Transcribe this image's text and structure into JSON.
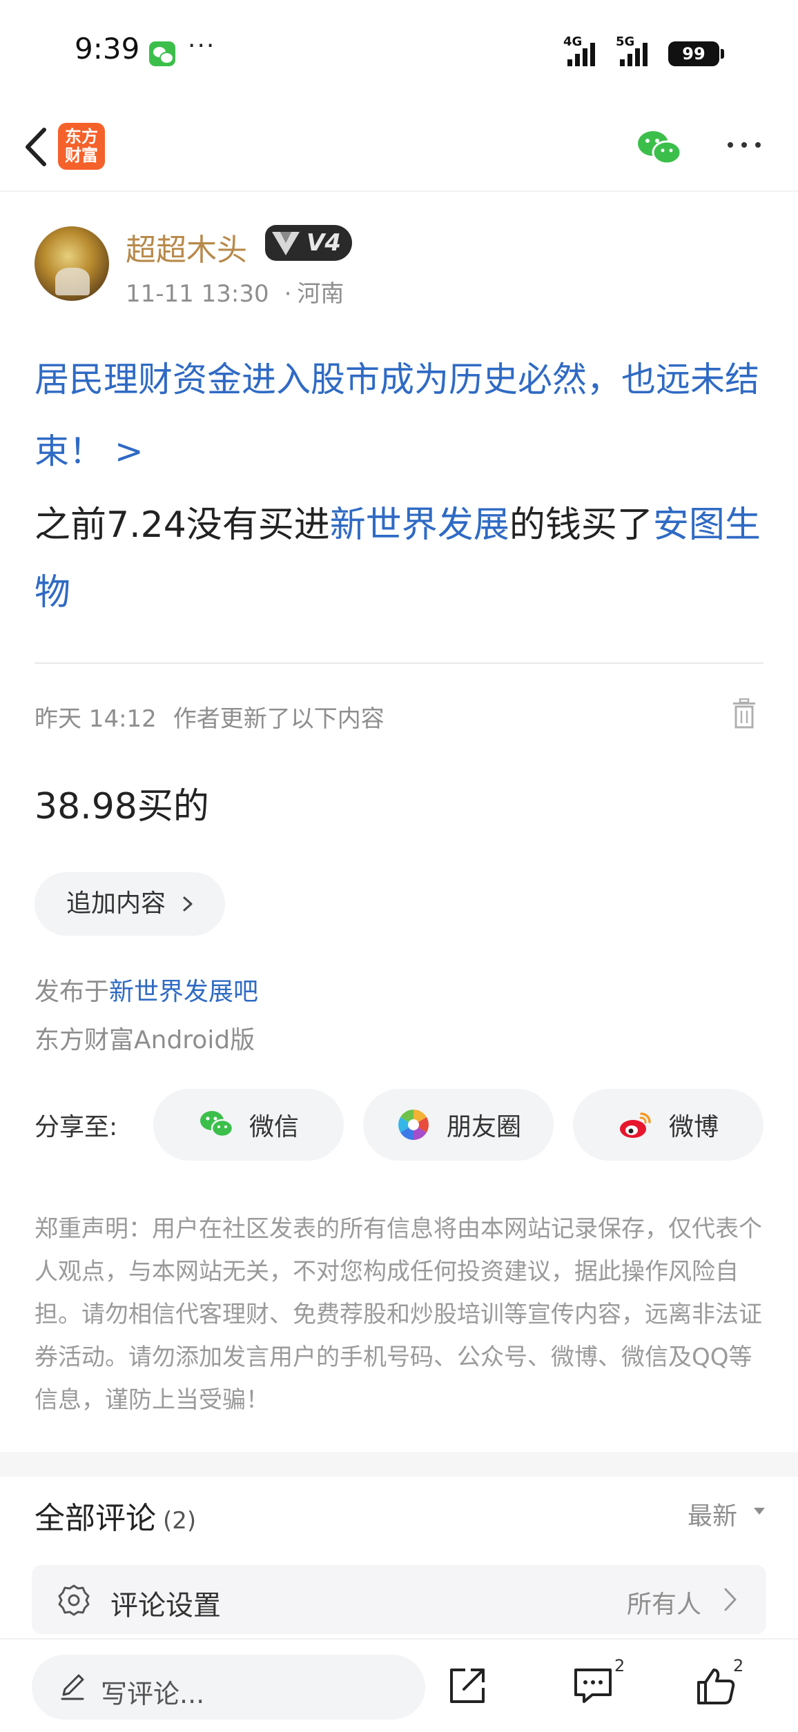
{
  "status_bar": {
    "time": "9:39",
    "dots": "···",
    "net1": "4G",
    "net2": "5G",
    "battery": "99"
  },
  "nav": {
    "logo_line1": "东方",
    "logo_line2": "财富"
  },
  "post": {
    "author": "超超木头",
    "level": "V4",
    "datetime": "11-11 13:30",
    "location_sep": "·",
    "location": "河南",
    "title": "居民理财资金进入股市成为历史必然，也远未结束！ >",
    "body_part1": "之前7.24没有买进",
    "body_stock1": "新世界发展",
    "body_part2": "的钱买了",
    "body_stock2": "安图生物",
    "update_time": "昨天 14:12",
    "update_label": "作者更新了以下内容",
    "update_body": "38.98买的",
    "append_label": "追加内容",
    "published_prefix": "发布于",
    "published_bar": "新世界发展吧",
    "client": "东方财富Android版"
  },
  "share": {
    "label": "分享至:",
    "wechat": "微信",
    "moments": "朋友圈",
    "weibo": "微博"
  },
  "disclaimer": "郑重声明：用户在社区发表的所有信息将由本网站记录保存，仅代表个人观点，与本网站无关，不对您构成任何投资建议，据此操作风险自担。请勿相信代客理财、免费荐股和炒股培训等宣传内容，远离非法证券活动。请勿添加发言用户的手机号码、公众号、微博、微信及QQ等信息，谨防上当受骗！",
  "comments": {
    "title": "全部评论",
    "count": "(2)",
    "sort": "最新",
    "settings_label": "评论设置",
    "settings_value": "所有人"
  },
  "bottom": {
    "write_placeholder": "写评论...",
    "comment_count": "2",
    "like_count": "2"
  },
  "colors": {
    "link_blue": "#2f6ac4",
    "author_gold": "#b8894a",
    "logo_orange": "#f5612a",
    "wechat_green": "#3bbf4a"
  }
}
